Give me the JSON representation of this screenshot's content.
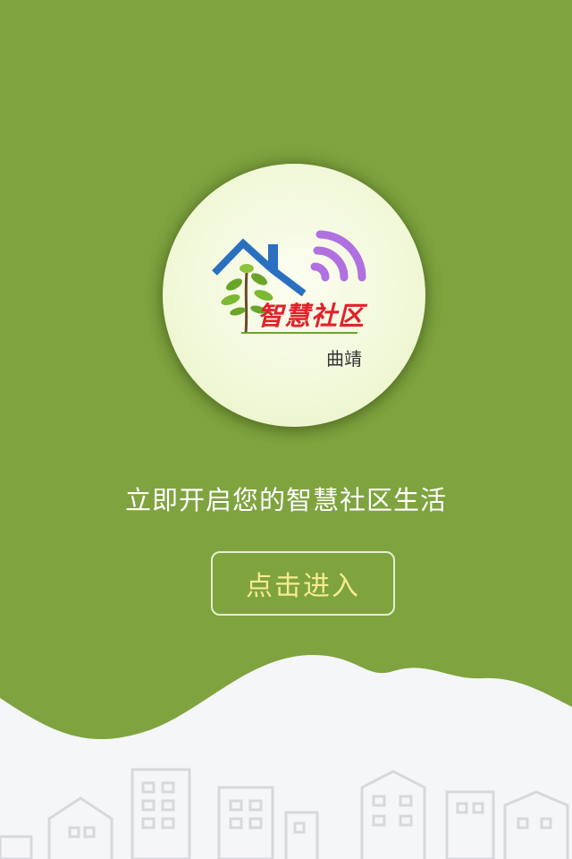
{
  "logo": {
    "brand": "智慧社区",
    "city": "曲靖",
    "icons": [
      "house-roof-icon",
      "tree-icon",
      "wifi-signal-icon"
    ],
    "colors": {
      "roof": "#2a6fc0",
      "brand": "#e2212b",
      "signal": "#b070e0",
      "tree": "#6aa52a"
    }
  },
  "tagline": "立即开启您的智慧社区生活",
  "enter_button": {
    "label": "点击进入"
  },
  "colors": {
    "background": "#7fa33f",
    "ground": "#f4f6f8",
    "buildings": "#d6d9dc",
    "button_text": "#f5ec90"
  }
}
